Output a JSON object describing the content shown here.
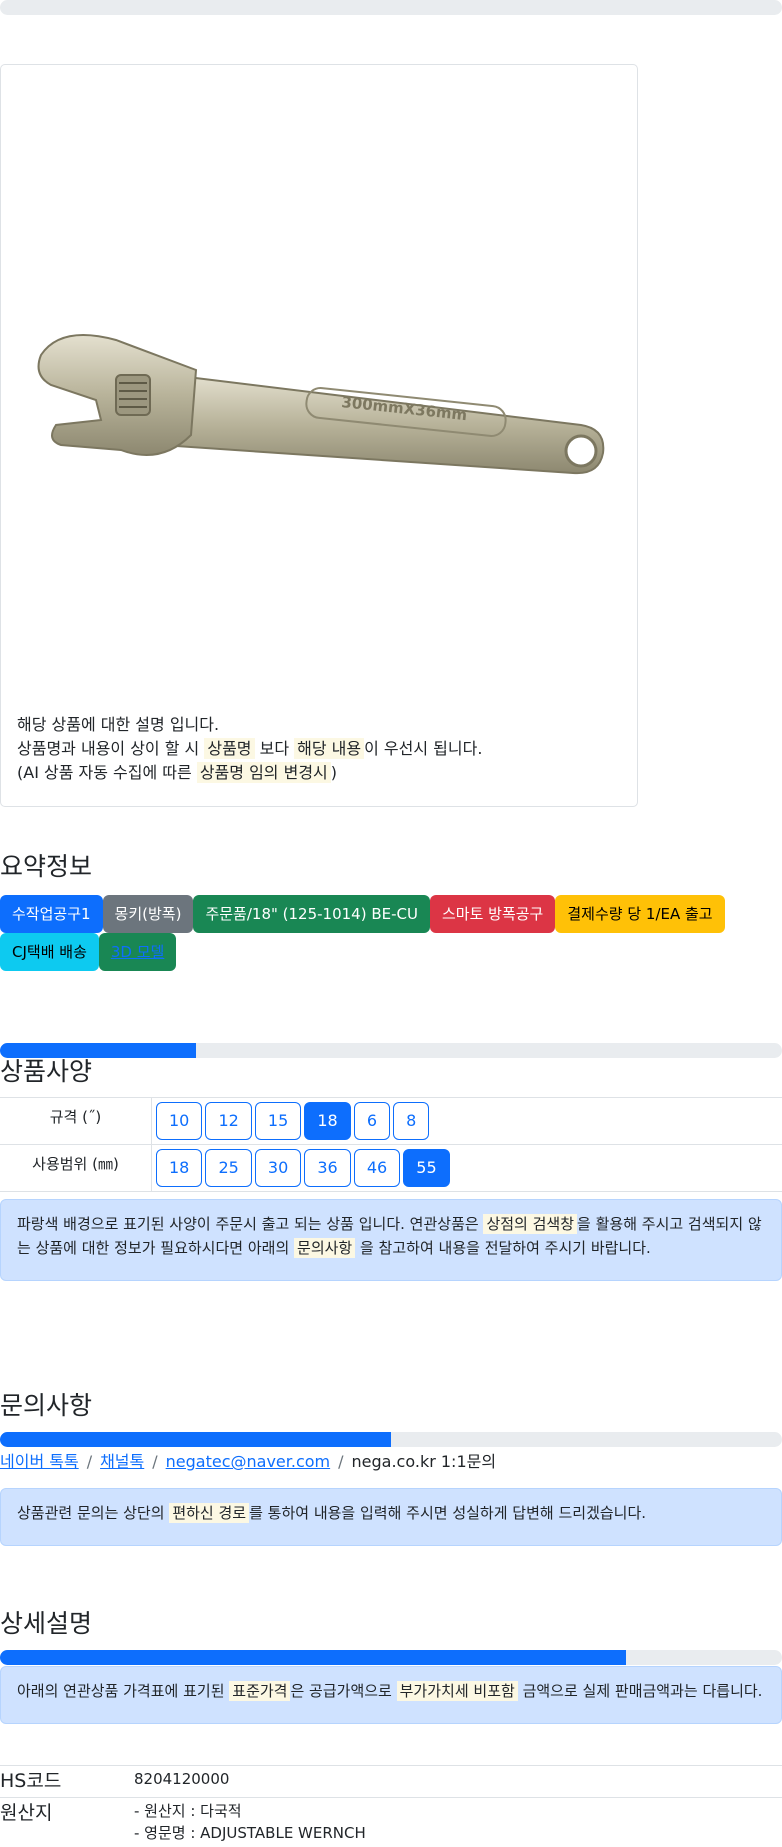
{
  "card": {
    "image_alt": "300mmX36mm",
    "lines": [
      {
        "a": "해당 상품에 대한 설명 입니다."
      },
      {
        "a": "상품명과 내용이 상이 할 시 ",
        "m1": "상품명",
        "b": " 보다 ",
        "m2": "해당 내용",
        "c": "이 우선시 됩니다."
      },
      {
        "a": "(AI 상품 자동 수집에 따른 ",
        "m1": "상품명 임의 변경시",
        "b": ")"
      }
    ]
  },
  "summary": {
    "title": "요약정보",
    "badges": [
      "수작업공구1",
      "몽키(방폭)",
      "주문품/18\" (125-1014) BE-CU",
      "스마토 방폭공구",
      "결제수량 당 1/EA 출고",
      "CJ택배 배송",
      "3D 모델"
    ]
  },
  "spec": {
    "title": "상품사양",
    "progress": 0.25,
    "rows": [
      {
        "label": "규격 (˝)",
        "options": [
          "10",
          "12",
          "15",
          "18",
          "6",
          "8"
        ],
        "selected": "18"
      },
      {
        "label": "사용범위 (㎜)",
        "options": [
          "18",
          "25",
          "30",
          "36",
          "46",
          "55"
        ],
        "selected": "55"
      }
    ],
    "notice": {
      "a": "파랑색 배경으로 표기된 사양이 주문시 출고 되는 상품 입니다. 연관상품은 ",
      "m1": "상점의 검색창",
      "b": "을 활용해 주시고 검색되지 않는 상품에 대한 정보가 필요하시다면 아래의 ",
      "m2": "문의사항",
      "c": " 을 참고하여 내용을 전달하여 주시기 바랍니다."
    }
  },
  "inquiry": {
    "title": "문의사항",
    "progress": 0.5,
    "links": [
      "네이버 톡톡",
      "채널톡",
      "negatec@naver.com"
    ],
    "plain": "nega.co.kr 1:1문의",
    "notice": {
      "a": "상품관련 문의는 상단의 ",
      "m1": "편하신 경로",
      "b": "를 통하여 내용을 입력해 주시면 성실하게 답변해 드리겠습니다."
    }
  },
  "detail": {
    "title": "상세설명",
    "progress": 0.8,
    "notice": {
      "a": "아래의 연관상품 가격표에 표기된 ",
      "m1": "표준가격",
      "b": "은 공급가액으로 ",
      "m2": "부가가치세 비포함",
      "c": " 금액으로 실제 판매금액과는 다릅니다."
    },
    "hs_label": "HS코드",
    "hs_value": "8204120000",
    "origin_label": "원산지",
    "origin_lines": [
      "- 원산지 : 다국적",
      "- 영문명 : ADJUSTABLE WERNCH"
    ]
  },
  "colors": {
    "primary": "#0d6efd",
    "alert_bg": "#cfe2ff",
    "mark": "#fcf8e3"
  }
}
